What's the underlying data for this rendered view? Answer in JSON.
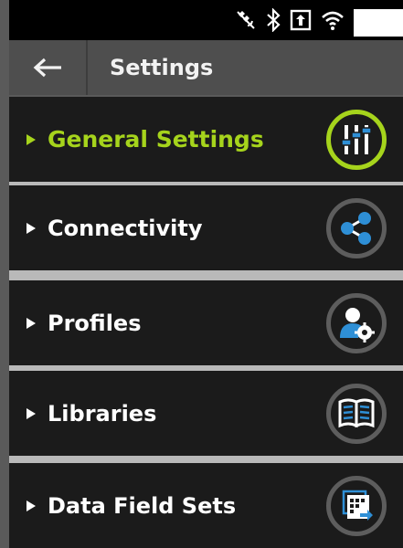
{
  "header": {
    "back_icon": "back-arrow-icon",
    "title": "Settings"
  },
  "status_bar": {
    "icons": [
      "gps-off-icon",
      "bluetooth-icon",
      "screen-icon",
      "wifi-icon",
      "battery-icon"
    ]
  },
  "menu": {
    "items": [
      {
        "label": "General Settings",
        "icon": "sliders-icon",
        "active": true
      },
      {
        "label": "Connectivity",
        "icon": "share-icon",
        "active": false
      },
      {
        "label": "Profiles",
        "icon": "user-settings-icon",
        "active": false
      },
      {
        "label": "Libraries",
        "icon": "book-icon",
        "active": false
      },
      {
        "label": "Data Field Sets",
        "icon": "data-fields-icon",
        "active": false
      }
    ]
  },
  "colors": {
    "accent": "#a6d41c",
    "item_bg": "#1b1b1b",
    "ring": "#5d5d5d",
    "icon": "#2e8fd6"
  }
}
